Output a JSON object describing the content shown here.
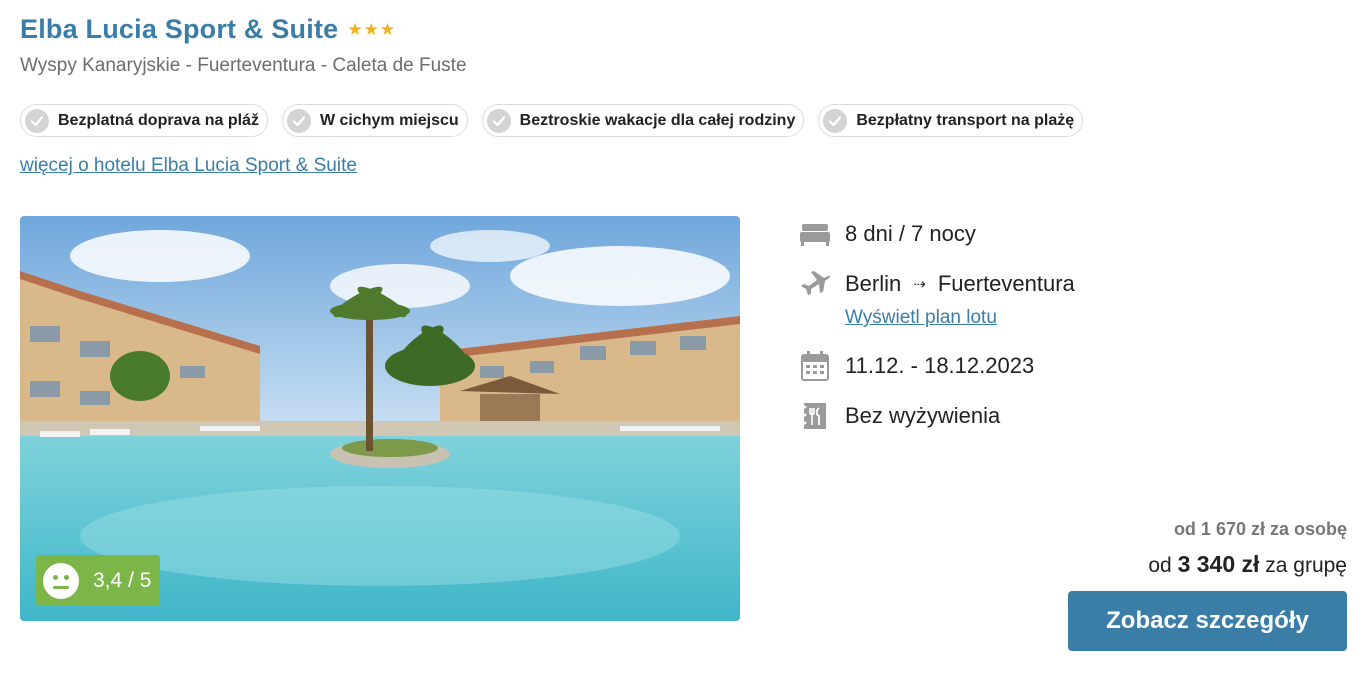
{
  "hotel": {
    "name": "Elba Lucia Sport & Suite",
    "stars": 3,
    "location": "Wyspy Kanaryjskie - Fuerteventura - Caleta de Fuste",
    "more_link": "więcej o hotelu Elba Lucia Sport & Suite"
  },
  "tags": [
    {
      "label": "Bezplatná doprava na pláž"
    },
    {
      "label": "W cichym miejscu"
    },
    {
      "label": "Beztroskie wakacje dla całej rodziny"
    },
    {
      "label": "Bezpłatny transport na plażę"
    }
  ],
  "rating": {
    "value": "3,4",
    "max": "5",
    "text": "3,4 / 5"
  },
  "trip": {
    "duration": "8 dni / 7 nocy",
    "from": "Berlin",
    "arrow": "⇢",
    "to": "Fuerteventura",
    "flight_plan_link": "Wyświetl plan lotu",
    "dates": "11.12. - 18.12.2023",
    "board": "Bez wyżywienia"
  },
  "price": {
    "per_person": "od 1 670 zł za osobę",
    "group_prefix": "od",
    "group_amount": "3 340 zł",
    "group_suffix": "za grupę"
  },
  "cta": {
    "label": "Zobacz szczegóły"
  },
  "colors": {
    "accent": "#3a7ea8",
    "rating": "#7cb548",
    "star": "#f2b01e"
  }
}
